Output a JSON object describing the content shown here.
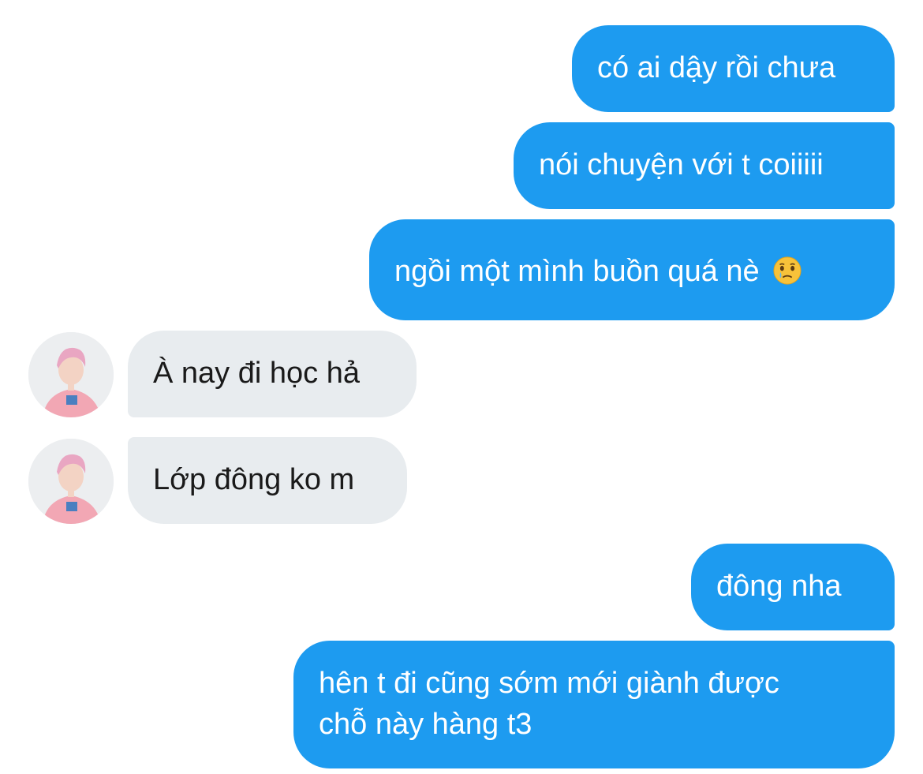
{
  "messages": [
    {
      "direction": "out",
      "text": "có ai dậy rồi chưa"
    },
    {
      "direction": "out",
      "text": "nói chuyện với t coiiiii"
    },
    {
      "direction": "out",
      "text": "ngồi một mình buồn quá nè",
      "emoji": "face-holding-back-tears-icon"
    },
    {
      "direction": "in",
      "text": "À nay đi học hả"
    },
    {
      "direction": "in",
      "text": "Lớp đông ko m"
    },
    {
      "direction": "out",
      "text": "đông nha"
    },
    {
      "direction": "out",
      "lines": [
        "hên t đi cũng sớm mới giành được",
        "chỗ này hàng t3"
      ]
    }
  ],
  "colors": {
    "outgoing_bubble": "#1d9bf0",
    "incoming_bubble": "#e8ecef",
    "outgoing_text": "#ffffff",
    "incoming_text": "#1a1a1a"
  }
}
